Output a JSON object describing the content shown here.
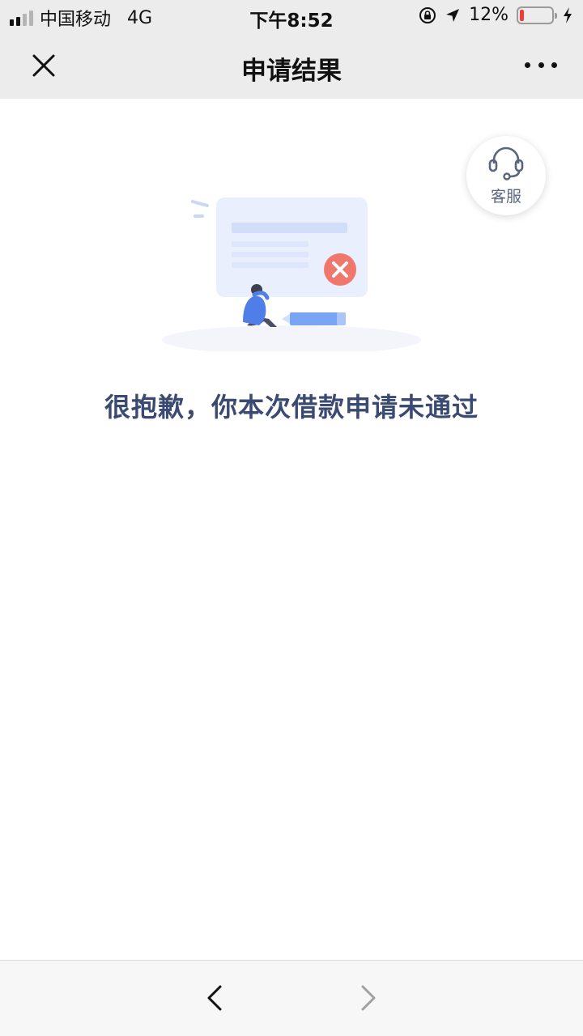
{
  "status_bar": {
    "carrier": "中国移动",
    "network": "4G",
    "time": "下午8:52",
    "battery_percent": "12%",
    "battery_level": 0.12,
    "signal_bars_active": 2,
    "signal_bars_total": 4,
    "icons": [
      "signal-icon",
      "rotation-lock-icon",
      "location-arrow-icon",
      "battery-icon",
      "charging-bolt-icon"
    ]
  },
  "nav": {
    "title": "申请结果",
    "close_icon": "close-icon",
    "more_icon": "more-icon"
  },
  "customer_service": {
    "label": "客服",
    "icon": "headset-icon"
  },
  "result": {
    "message": "很抱歉，你本次借款申请未通过",
    "illustration_icon": "rejected-application-illustration"
  },
  "bottom_bar": {
    "back_icon": "chevron-left-icon",
    "forward_icon": "chevron-right-icon",
    "forward_enabled": false
  },
  "colors": {
    "nav_background": "#ececec",
    "message_text": "#3b4a72",
    "error_badge": "#f0776b",
    "battery_low": "#f03b3b",
    "accent_blue": "#4f7ee8"
  }
}
